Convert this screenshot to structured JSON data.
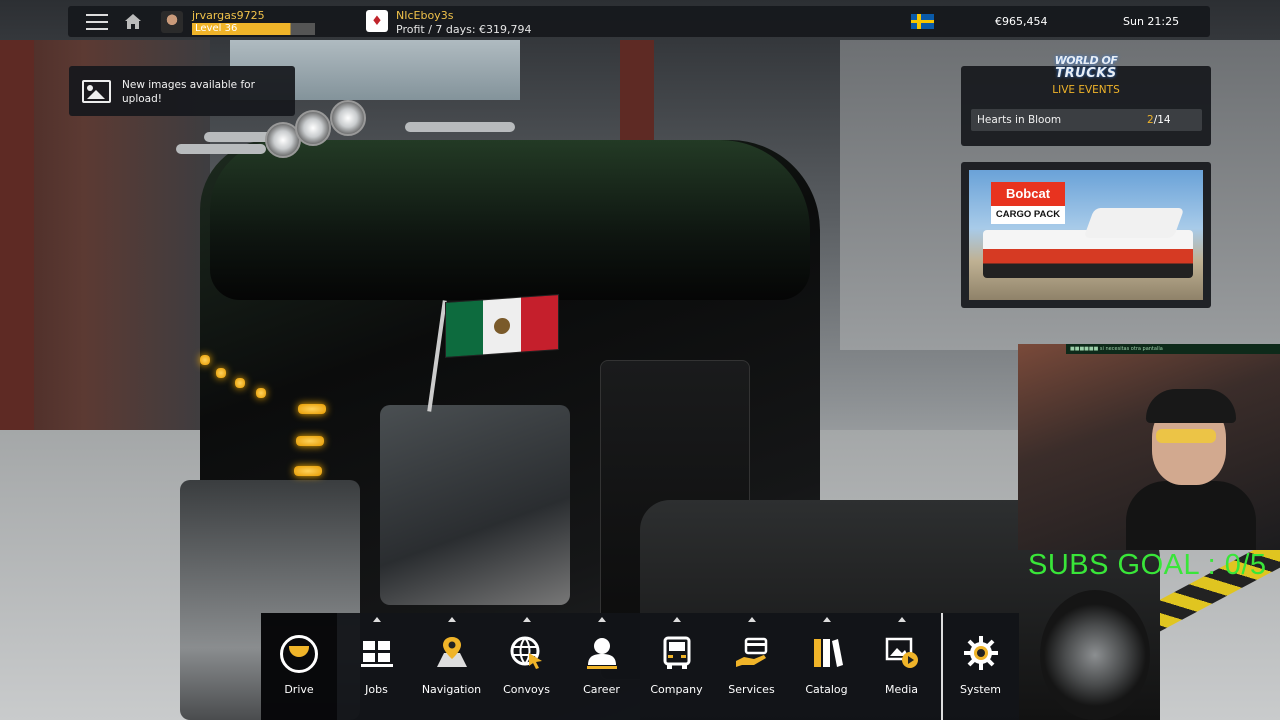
{
  "topbar": {
    "username": "jrvargas9725",
    "level": "Level 36",
    "level_progress": 0.8,
    "company_name": "NIcEboy3s",
    "company_profit": "Profit / 7 days: €319,794",
    "money": "€965,454",
    "clock": "Sun 21:25"
  },
  "notification": {
    "text": "New images available for upload!"
  },
  "live_events": {
    "logo_line1": "WORLD OF",
    "logo_line2": "TRUCKS",
    "title": "LIVE EVENTS",
    "event_name": "Hearts in Bloom",
    "event_current": "2",
    "event_total": "/14"
  },
  "promo": {
    "brand": "Bobcat",
    "subtitle": "CARGO PACK"
  },
  "overlay": {
    "subs_goal": "SUBS GOAL : 0/5",
    "chat_text": "■■■■■■  si necesitas otra pantalla"
  },
  "dock": {
    "drive": "Drive",
    "jobs": "Jobs",
    "navigation": "Navigation",
    "convoys": "Convoys",
    "career": "Career",
    "company": "Company",
    "services": "Services",
    "catalog": "Catalog",
    "media": "Media",
    "system": "System"
  },
  "colors": {
    "accent": "#f0b429",
    "panel": "#16181c",
    "subs_goal": "#39e639"
  }
}
